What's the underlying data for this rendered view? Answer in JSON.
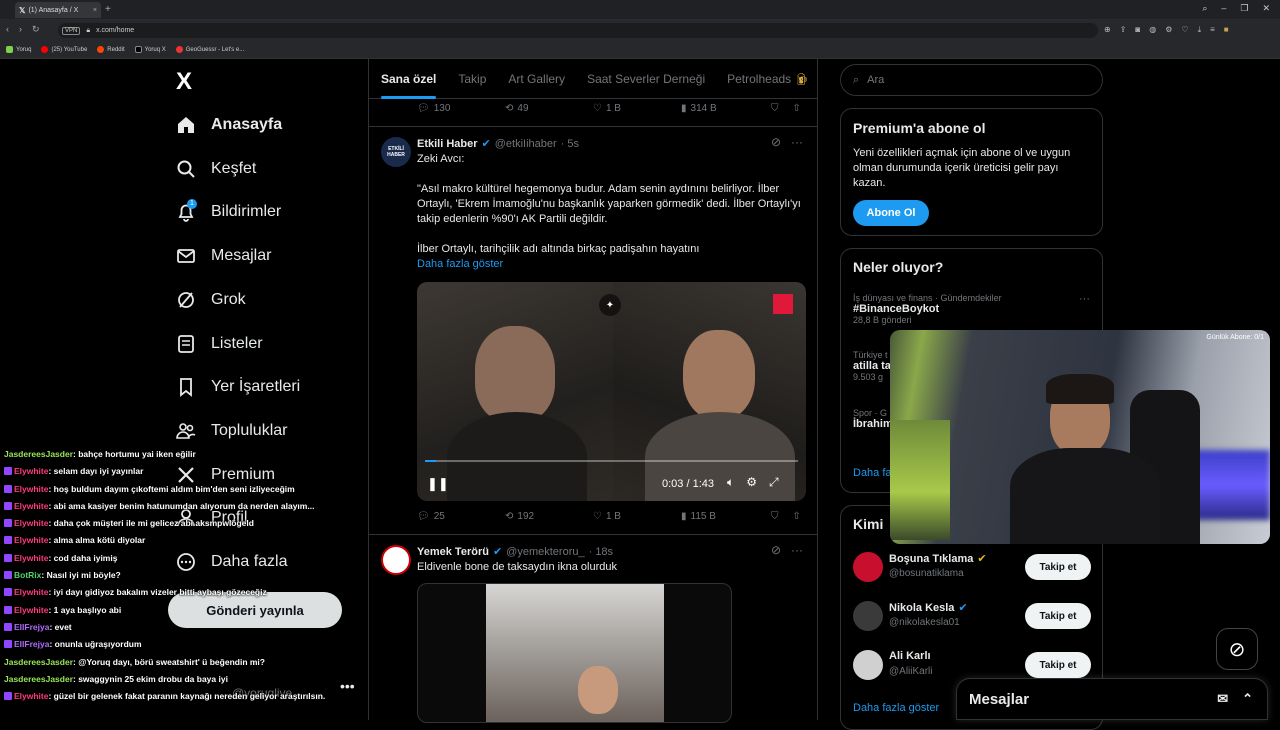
{
  "browser": {
    "tab_title": "(1) Anasayfa / X",
    "url": "x.com/home",
    "vpn": "VPN",
    "bookmarks": [
      "Yoruq",
      "(25) YouTube",
      "Reddit",
      "Yoruq X",
      "GeoGuessr - Let's e..."
    ]
  },
  "nav": {
    "logo": "X",
    "items": [
      {
        "label": "Anasayfa",
        "icon": "home-icon"
      },
      {
        "label": "Keşfet",
        "icon": "search-icon"
      },
      {
        "label": "Bildirimler",
        "icon": "bell-icon",
        "badge": "1"
      },
      {
        "label": "Mesajlar",
        "icon": "mail-icon"
      },
      {
        "label": "Grok",
        "icon": "grok-icon"
      },
      {
        "label": "Listeler",
        "icon": "list-icon"
      },
      {
        "label": "Yer İşaretleri",
        "icon": "bookmark-icon"
      },
      {
        "label": "Topluluklar",
        "icon": "community-icon"
      },
      {
        "label": "Premium",
        "icon": "x-premium-icon"
      },
      {
        "label": "Profil",
        "icon": "user-icon"
      },
      {
        "label": "Daha fazla",
        "icon": "more-circle-icon"
      }
    ],
    "post_button": "Gönderi yayınla",
    "user_handle": "@yoruqlive"
  },
  "feed": {
    "tabs": [
      "Sana özel",
      "Takip",
      "Art Gallery",
      "Saat Severler Derneği",
      "Petrolheads"
    ],
    "prev_post_actions": {
      "replies": "130",
      "reposts": "49",
      "likes": "1 B",
      "views": "314 B"
    },
    "post1": {
      "name": "Etkili Haber",
      "handle": "@etkiIihaber",
      "time": "· 5s",
      "avatar_text": "ETKİLİ HABER",
      "text_line1": "Zeki Avcı:",
      "text_quote": "\"Asıl makro kültürel hegemonya budur. Adam senin aydınını belirliyor. İlber Ortaylı, 'Ekrem İmamoğlu'nu başkanlık yaparken görmedik' dedi. İlber Ortaylı'yı takip edenlerin %90'ı AK Partili değildir.",
      "text_line3": "İlber Ortaylı, tarihçilik adı altında birkaç padişahın hayatını",
      "show_more": "Daha fazla göster",
      "video_time": "0:03 / 1:43",
      "video_progress": 0.03,
      "actions": {
        "replies": "25",
        "reposts": "192",
        "likes": "1 B",
        "views": "115 B"
      }
    },
    "post2": {
      "name": "Yemek Terörü",
      "handle": "@yemekteroru_",
      "time": "· 18s",
      "text": "Eldivenle bone de taksaydın ikna olurduk"
    }
  },
  "right": {
    "search_placeholder": "Ara",
    "premium": {
      "title": "Premium'a abone ol",
      "desc": "Yeni özellikleri açmak için abone ol ve uygun olman durumunda içerik üreticisi gelir payı kazan.",
      "button": "Abone Ol"
    },
    "trends": {
      "title": "Neler oluyor?",
      "items": [
        {
          "meta": "İş dünyası ve finans · Gündemdekiler",
          "name": "#BinanceBoykot",
          "count": "28,8 B gönderi"
        },
        {
          "meta": "Türkiye t",
          "name": "atilla ta",
          "count": "9.503 g"
        },
        {
          "meta": "Spor · G",
          "name": "İbrahim",
          "count": ""
        }
      ],
      "more": "Daha fa"
    },
    "who": {
      "title": "Kimi",
      "items": [
        {
          "name": "Boşuna Tıklama",
          "handle": "@bosunatiklama",
          "verified": "gold",
          "button": "Takip et"
        },
        {
          "name": "Nikola Kesla",
          "handle": "@nikolakesla01",
          "verified": "blue",
          "button": "Takip et"
        },
        {
          "name": "Ali Karlı",
          "handle": "@AliiKarli",
          "verified": "",
          "button": "Takip et"
        }
      ],
      "more": "Daha fazla göster"
    },
    "messages": "Mesajlar"
  },
  "webcam": {
    "label": "Günlük Abone: 0/1"
  },
  "chat": [
    {
      "user": "JasdereesJasder",
      "color": "#9ae65a",
      "msg": ": bahçe hortumu yai iken eğilir",
      "tw": false
    },
    {
      "user": "Elywhite",
      "color": "#ff3b7a",
      "msg": ": selam dayı iyi yayınlar",
      "tw": true
    },
    {
      "user": "Elywhite",
      "color": "#ff3b7a",
      "msg": ": hoş buldum dayım çıkoftemi aldım bim'den seni izliyeceğim",
      "tw": true
    },
    {
      "user": "Elywhite",
      "color": "#ff3b7a",
      "msg": ": abi ama kasiyer benim hatunumdan alıyorum da nerden alayım...",
      "tw": true
    },
    {
      "user": "Elywhite",
      "color": "#ff3b7a",
      "msg": ": daha çok müşteri ile mi gelicez abi aksmpwlögeld",
      "tw": true
    },
    {
      "user": "Elywhite",
      "color": "#ff3b7a",
      "msg": ": alma alma kötü diyolar",
      "tw": true
    },
    {
      "user": "Elywhite",
      "color": "#ff3b7a",
      "msg": ": cod daha iyimiş",
      "tw": true
    },
    {
      "user": "BotRix",
      "color": "#52d36b",
      "msg": ": Nasıl iyi mi böyle?",
      "tw": true
    },
    {
      "user": "Elywhite",
      "color": "#ff3b7a",
      "msg": ": iyi dayı gidiyoz bakalım vizeler bitti aybaşı gözeceğiz",
      "tw": true
    },
    {
      "user": "Elywhite",
      "color": "#ff3b7a",
      "msg": ": 1 aya başlıyo abi",
      "tw": true
    },
    {
      "user": "EllFrejya",
      "color": "#b36bff",
      "msg": ": evet",
      "tw": true
    },
    {
      "user": "EllFrejya",
      "color": "#b36bff",
      "msg": ": onunla uğraşıyordum",
      "tw": true
    },
    {
      "user": "JasdereesJasder",
      "color": "#9ae65a",
      "msg": ": @Yoruq dayı, börü sweatshirt' ü beğendin mi?",
      "tw": false
    },
    {
      "user": "JasdereesJasder",
      "color": "#9ae65a",
      "msg": ": swaggynin 25 ekim drobu da baya iyi",
      "tw": false
    },
    {
      "user": "Elywhite",
      "color": "#ff3b7a",
      "msg": ": güzel bir gelenek fakat paranın kaynağı nereden geliyor araştırılsın.",
      "tw": true
    }
  ],
  "colors": {
    "accent": "#1d9bf0",
    "border": "#2f3336",
    "muted": "#71767b"
  }
}
